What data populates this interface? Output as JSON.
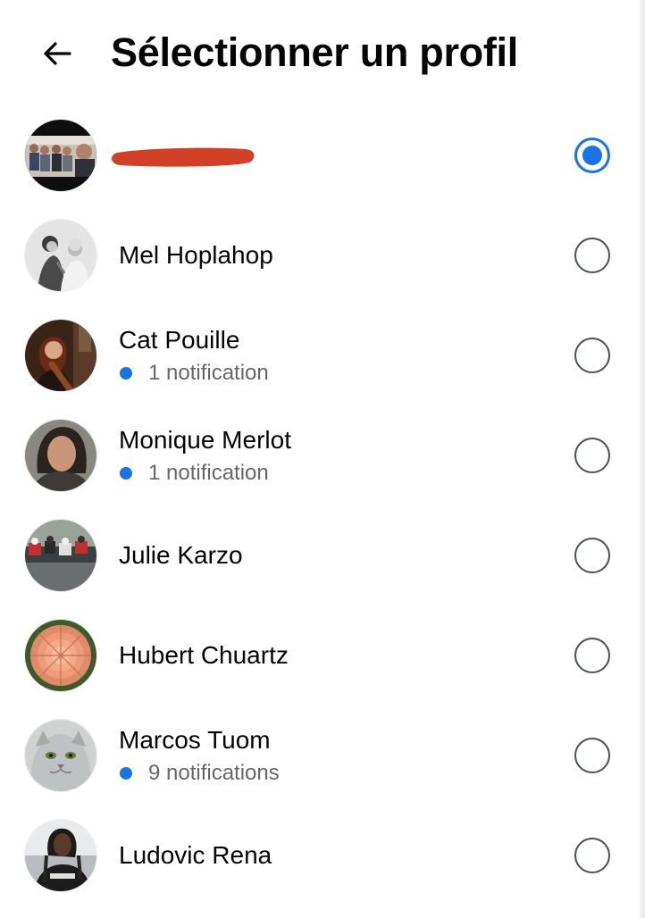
{
  "header": {
    "title": "Sélectionner un profil",
    "back_icon": "arrow-left-icon"
  },
  "profiles": [
    {
      "name": "",
      "name_redacted": true,
      "notification": "",
      "selected": true
    },
    {
      "name": "Mel Hoplahop",
      "notification": "",
      "selected": false
    },
    {
      "name": "Cat Pouille",
      "notification": "1 notification",
      "selected": false
    },
    {
      "name": "Monique Merlot",
      "notification": "1 notification",
      "selected": false
    },
    {
      "name": "Julie Karzo",
      "notification": "",
      "selected": false
    },
    {
      "name": "Hubert Chuartz",
      "notification": "",
      "selected": false
    },
    {
      "name": "Marcos Tuom",
      "notification": "9 notifications",
      "selected": false
    },
    {
      "name": "Ludovic Rena",
      "notification": "",
      "selected": false
    }
  ],
  "colors": {
    "accent": "#1b74e4",
    "redaction": "#d23f27",
    "secondary_text": "#65676b"
  }
}
